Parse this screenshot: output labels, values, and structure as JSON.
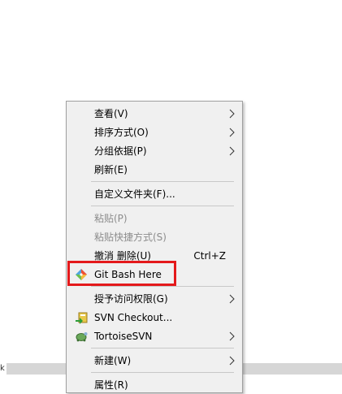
{
  "context_menu": {
    "items": [
      {
        "label": "查看(V)",
        "has_submenu": true,
        "disabled": false
      },
      {
        "label": "排序方式(O)",
        "has_submenu": true,
        "disabled": false
      },
      {
        "label": "分组依据(P)",
        "has_submenu": true,
        "disabled": false
      },
      {
        "label": "刷新(E)",
        "has_submenu": false,
        "disabled": false
      },
      {
        "label": "自定义文件夹(F)...",
        "has_submenu": false,
        "disabled": false
      },
      {
        "label": "粘贴(P)",
        "has_submenu": false,
        "disabled": true
      },
      {
        "label": "粘贴快捷方式(S)",
        "has_submenu": false,
        "disabled": true
      },
      {
        "label": "撤消 删除(U)",
        "shortcut": "Ctrl+Z",
        "has_submenu": false,
        "disabled": false
      },
      {
        "label": "Git Bash Here",
        "icon": "git-icon",
        "has_submenu": false,
        "disabled": false
      },
      {
        "label": "授予访问权限(G)",
        "has_submenu": true,
        "disabled": false
      },
      {
        "label": "SVN Checkout...",
        "icon": "svn-checkout-icon",
        "has_submenu": false,
        "disabled": false
      },
      {
        "label": "TortoiseSVN",
        "icon": "tortoisesvn-icon",
        "has_submenu": true,
        "disabled": false
      },
      {
        "label": "新建(W)",
        "has_submenu": true,
        "disabled": false
      },
      {
        "label": "属性(R)",
        "has_submenu": false,
        "disabled": false
      }
    ]
  },
  "bottom_bar": {
    "left_char": "k"
  },
  "colors": {
    "menu_background": "#f0f0f0",
    "highlight_border": "#e4191b",
    "disabled_text": "#8c8c8c"
  }
}
